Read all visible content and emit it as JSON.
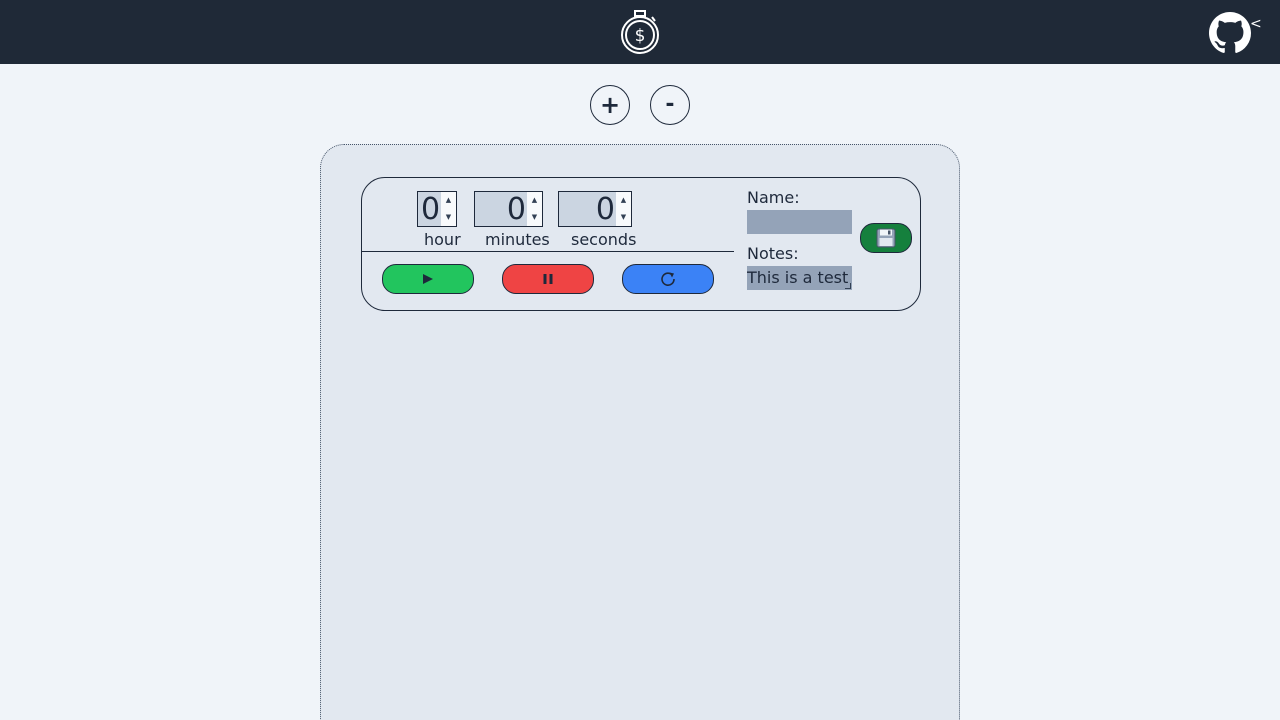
{
  "header": {
    "logo_icon": "stopwatch-dollar-icon",
    "github_icon": "github-icon",
    "collapse_glyph": "<"
  },
  "toolbar": {
    "add_label": "+",
    "remove_label": "-"
  },
  "timer": {
    "hour_value": "0",
    "minutes_value": "0",
    "seconds_value": "0",
    "hour_label": "hour",
    "minutes_label": "minutes",
    "seconds_label": "seconds",
    "name_label": "Name:",
    "name_value": "",
    "notes_label": "Notes:",
    "notes_value": "This is a test",
    "play_icon": "play-icon",
    "pause_icon": "pause-icon",
    "reset_icon": "reset-icon",
    "save_icon": "floppy-disk-icon"
  },
  "colors": {
    "header_bg": "#1f2937",
    "page_bg": "#f0f4f9",
    "board_bg": "#e2e8f0",
    "play": "#22c55e",
    "pause": "#ef4444",
    "reset": "#3b82f6",
    "save": "#15803d",
    "input_bg": "#94a3b8"
  }
}
